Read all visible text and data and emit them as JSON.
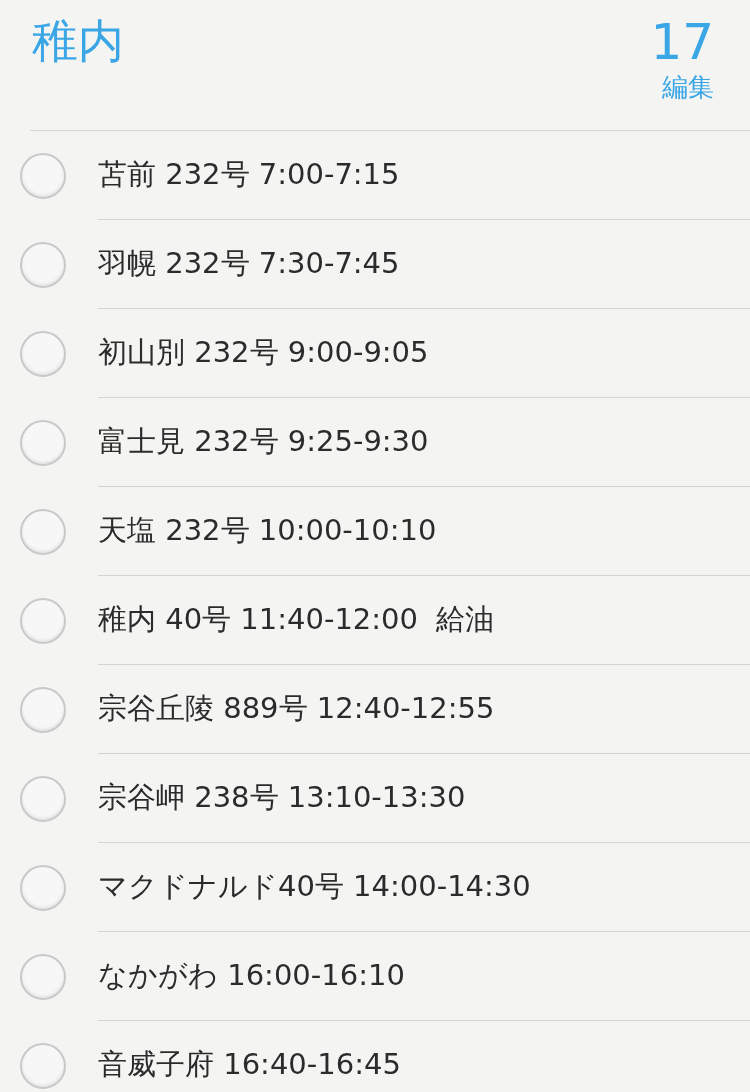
{
  "list": {
    "title": "稚内",
    "count": "17",
    "edit": "編集"
  },
  "items": [
    {
      "text": "苫前 232号 7:00-7:15",
      "checked": false
    },
    {
      "text": "羽幌 232号 7:30-7:45",
      "checked": false
    },
    {
      "text": "初山別 232号 9:00-9:05",
      "checked": false
    },
    {
      "text": "富士見 232号 9:25-9:30",
      "checked": false
    },
    {
      "text": "天塩 232号 10:00-10:10",
      "checked": false
    },
    {
      "text": "稚内 40号 11:40-12:00  給油",
      "checked": false
    },
    {
      "text": "宗谷丘陵 889号 12:40-12:55",
      "checked": false
    },
    {
      "text": "宗谷岬 238号 13:10-13:30",
      "checked": false
    },
    {
      "text": "マクドナルド40号 14:00-14:30",
      "checked": false
    },
    {
      "text": "なかがわ 16:00-16:10",
      "checked": false
    },
    {
      "text": "音威子府 16:40-16:45",
      "checked": false
    }
  ]
}
